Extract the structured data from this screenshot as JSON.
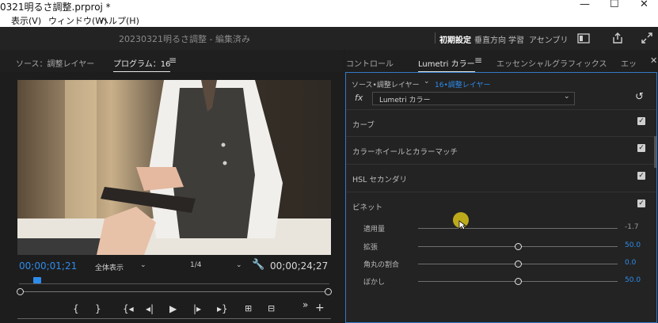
{
  "window": {
    "title": "0321明るさ調整.prproj *",
    "controls": {
      "minimize": "—",
      "maximize": "☐",
      "close": "✕"
    }
  },
  "menu": {
    "items": [
      "表示(V)",
      "ウィンドウ(W)",
      "ヘルプ(H)"
    ]
  },
  "app": {
    "project_title": "20230321明るさ調整 - 編集済み",
    "workspaces": [
      "初期設定",
      "垂直方向",
      "学習",
      "アセンブリ"
    ]
  },
  "source_panel": {
    "tab_source": "ソース：調整レイヤー",
    "tab_program": "プログラム：16",
    "current_time": "00;00;01;21",
    "zoom": "全体表示",
    "resolution": "1/4",
    "duration": "00;00;24;27"
  },
  "right_panel": {
    "tabs": [
      "コントロール",
      "Lumetri カラー",
      "エッセンシャルグラフィックス",
      "エッ"
    ]
  },
  "lumetri": {
    "breadcrumb_source": "ソース•調整レイヤー",
    "breadcrumb_sequence": "16•調整レイヤー",
    "fx_label": "fx",
    "effect_select": "Lumetri カラー",
    "sections": [
      "カーブ",
      "カラーホイールとカラーマッチ",
      "HSL セカンダリ",
      "ビネット"
    ],
    "vignette": [
      {
        "label": "適用量",
        "value": "-1.7",
        "level": 0.21
      },
      {
        "label": "拡張",
        "value": "50.0",
        "level": 0.5
      },
      {
        "label": "角丸の割合",
        "value": "0.0",
        "level": 0.5
      },
      {
        "label": "ぼかし",
        "value": "50.0",
        "level": 0.5
      }
    ]
  },
  "colors": {
    "accent": "#2d8ceb",
    "panel_border": "#3479c6"
  }
}
